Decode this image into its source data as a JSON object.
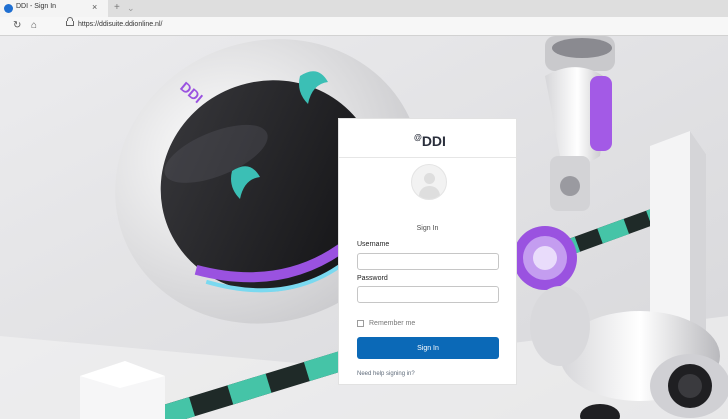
{
  "browser": {
    "tab": {
      "title": "DDI - Sign In",
      "close": "×"
    },
    "new_tab": "+",
    "tab_more": "⌄",
    "nav": {
      "refresh": "↻",
      "home": "⌂"
    },
    "url": "https://ddisuite.ddionline.nl/"
  },
  "scene": {
    "robot_badge": "DDI"
  },
  "login": {
    "logo": {
      "prefix": "@",
      "text": "DDI"
    },
    "heading": "Sign In",
    "username_label": "Username",
    "username_value": "",
    "password_label": "Password",
    "password_value": "",
    "remember_label": "Remember me",
    "signin_button": "Sign In",
    "help_link": "Need help signing in?"
  },
  "colors": {
    "primary_button": "#0b69b7",
    "accent_purple": "#9a52e0",
    "accent_teal": "#45c4a7"
  }
}
